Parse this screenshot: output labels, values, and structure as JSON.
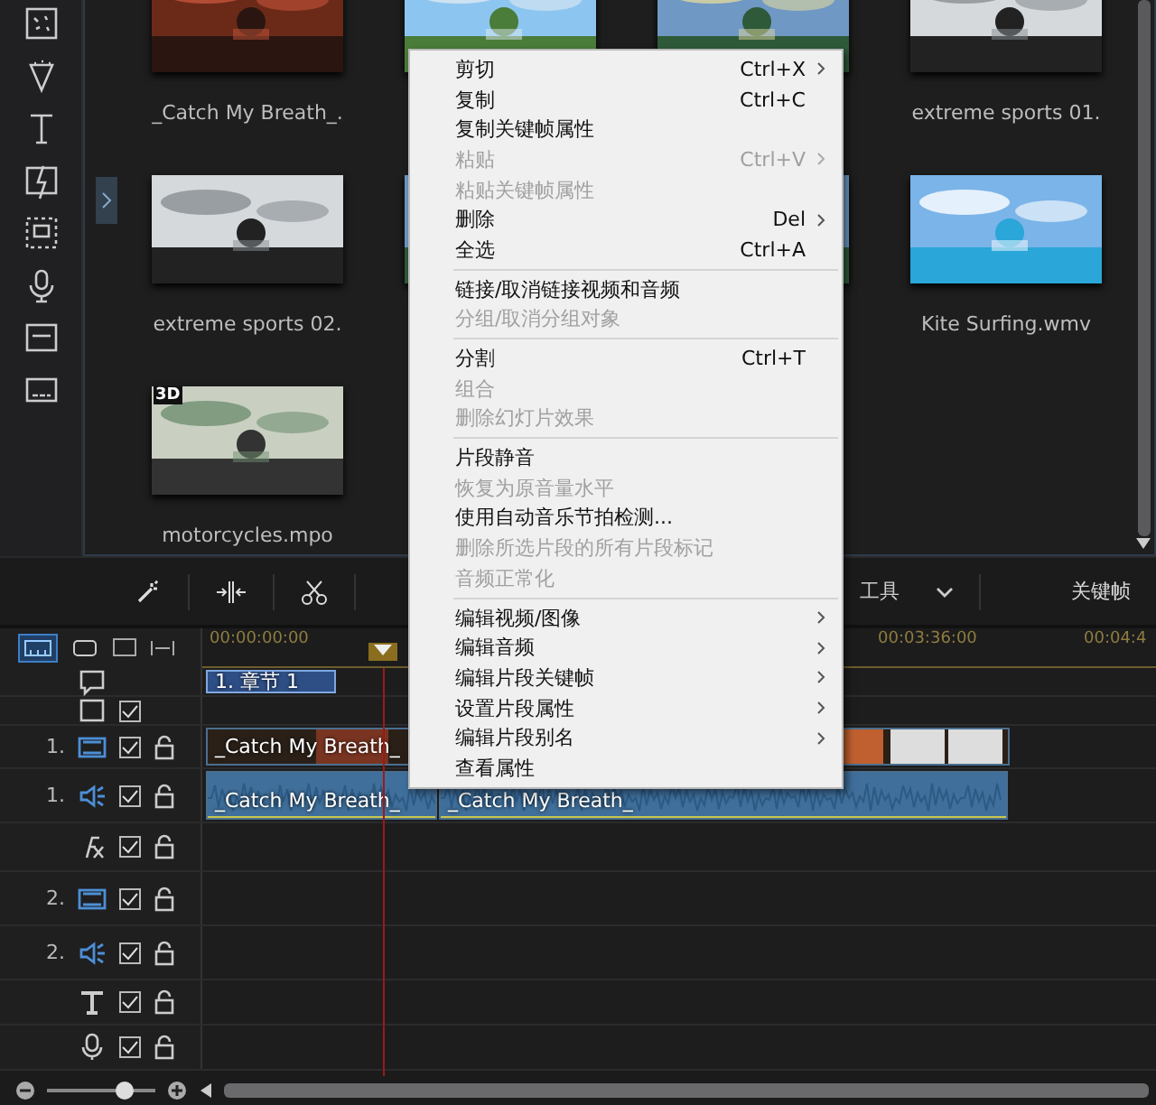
{
  "sidebar": {
    "tools": [
      {
        "kind": "effects"
      },
      {
        "kind": "particles"
      },
      {
        "kind": "title"
      },
      {
        "kind": "transition"
      },
      {
        "kind": "pip"
      },
      {
        "kind": "audio"
      },
      {
        "kind": "chapter"
      },
      {
        "kind": "subtitle"
      }
    ]
  },
  "media": {
    "items": [
      {
        "label": "_Catch My Breath_.",
        "kind": "concert"
      },
      {
        "kind": "balloons"
      },
      {
        "kind": "lake"
      },
      {
        "label": "extreme sports 01.",
        "kind": "bike"
      },
      {
        "label": "extreme sports 02.",
        "kind": "bike"
      },
      {
        "kind": "lake"
      },
      {
        "kind": "lake"
      },
      {
        "label": "Kite Surfing.wmv",
        "kind": "beach"
      },
      {
        "label": "motorcycles.mpo",
        "kind": "motorcycles",
        "badge": "3D"
      }
    ]
  },
  "toolbar": {
    "tools_label": "工具",
    "keyframe_label": "关键帧"
  },
  "view_modes": [
    {
      "kind": "timeline",
      "selected": true
    },
    {
      "kind": "storyboard",
      "selected": false
    }
  ],
  "ruler": {
    "times": [
      "00:00:00:00",
      "00:03:36:00",
      "00:04:4"
    ]
  },
  "tracks": [
    {
      "kind": "chapter",
      "clips": [
        {
          "label": "1. 章节 1",
          "kind": "chapter"
        }
      ]
    },
    {
      "kind": "subtitle",
      "checked": true
    },
    {
      "kind": "video",
      "number": "1.",
      "checked": true,
      "clips": [
        {
          "label": "_Catch My Breath_",
          "kind": "video"
        }
      ]
    },
    {
      "kind": "audio",
      "number": "1.",
      "checked": true,
      "clips": [
        {
          "label": "_Catch My Breath_",
          "kind": "audio"
        },
        {
          "label": "_Catch My Breath_",
          "kind": "audio2"
        }
      ]
    },
    {
      "kind": "fx",
      "checked": true
    },
    {
      "kind": "video",
      "number": "2.",
      "checked": true
    },
    {
      "kind": "audio",
      "number": "2.",
      "checked": true
    },
    {
      "kind": "title",
      "checked": true
    },
    {
      "kind": "voice",
      "checked": true
    }
  ],
  "zoom": {
    "level": 0.72
  },
  "context_menu": [
    {
      "kind": "item",
      "label": "剪切",
      "shortcut": "Ctrl+X",
      "submenu": true,
      "disabled": false
    },
    {
      "kind": "item",
      "label": "复制",
      "shortcut": "Ctrl+C",
      "submenu": false,
      "disabled": false
    },
    {
      "kind": "item",
      "label": "复制关键帧属性",
      "submenu": false,
      "disabled": false
    },
    {
      "kind": "item",
      "label": "粘贴",
      "shortcut": "Ctrl+V",
      "submenu": true,
      "disabled": true
    },
    {
      "kind": "item",
      "label": "粘贴关键帧属性",
      "submenu": false,
      "disabled": true
    },
    {
      "kind": "item",
      "label": "删除",
      "shortcut": "Del",
      "submenu": true,
      "disabled": false
    },
    {
      "kind": "item",
      "label": "全选",
      "shortcut": "Ctrl+A",
      "submenu": false,
      "disabled": false
    },
    {
      "kind": "separator"
    },
    {
      "kind": "item",
      "label": "链接/取消链接视频和音频",
      "submenu": false,
      "disabled": false
    },
    {
      "kind": "item",
      "label": "分组/取消分组对象",
      "submenu": false,
      "disabled": true
    },
    {
      "kind": "separator"
    },
    {
      "kind": "item",
      "label": "分割",
      "shortcut": "Ctrl+T",
      "submenu": false,
      "disabled": false
    },
    {
      "kind": "item",
      "label": "组合",
      "submenu": false,
      "disabled": true
    },
    {
      "kind": "item",
      "label": "删除幻灯片效果",
      "submenu": false,
      "disabled": true
    },
    {
      "kind": "separator"
    },
    {
      "kind": "item",
      "label": "片段静音",
      "submenu": false,
      "disabled": false
    },
    {
      "kind": "item",
      "label": "恢复为原音量水平",
      "submenu": false,
      "disabled": true
    },
    {
      "kind": "item",
      "label": "使用自动音乐节拍检测...",
      "submenu": false,
      "disabled": false
    },
    {
      "kind": "item",
      "label": "删除所选片段的所有片段标记",
      "submenu": false,
      "disabled": true
    },
    {
      "kind": "item",
      "label": "音频正常化",
      "submenu": false,
      "disabled": true
    },
    {
      "kind": "separator"
    },
    {
      "kind": "item",
      "label": "编辑视频/图像",
      "submenu": true,
      "disabled": false
    },
    {
      "kind": "item",
      "label": "编辑音频",
      "submenu": true,
      "disabled": false
    },
    {
      "kind": "item",
      "label": "编辑片段关键帧",
      "submenu": true,
      "disabled": false
    },
    {
      "kind": "item",
      "label": "设置片段属性",
      "submenu": true,
      "disabled": false
    },
    {
      "kind": "item",
      "label": "编辑片段别名",
      "submenu": true,
      "disabled": false
    },
    {
      "kind": "item",
      "label": "查看属性",
      "submenu": false,
      "disabled": false
    }
  ]
}
